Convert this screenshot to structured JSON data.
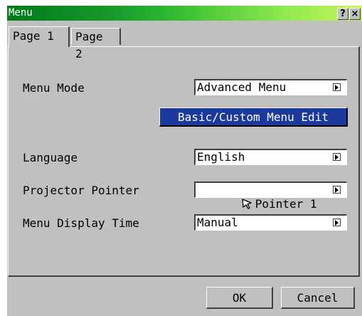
{
  "window": {
    "title": "Menu",
    "help_label": "?",
    "close_label": "×"
  },
  "tabs": [
    {
      "label": "Page 1",
      "active": true
    },
    {
      "label": "Page 2",
      "active": false
    }
  ],
  "settings": {
    "menu_mode": {
      "label": "Menu Mode",
      "value": "Advanced Menu"
    },
    "custom_edit_label": "Basic/Custom Menu Edit",
    "language": {
      "label": "Language",
      "value": "English"
    },
    "projector_pointer": {
      "label": "Projector Pointer",
      "value": "Pointer 1"
    },
    "menu_display_time": {
      "label": "Menu Display Time",
      "value": "Manual"
    }
  },
  "footer": {
    "ok_label": "OK",
    "cancel_label": "Cancel"
  },
  "colors": {
    "accent": "#1c3a9e",
    "titlebar": "#2cb830"
  }
}
